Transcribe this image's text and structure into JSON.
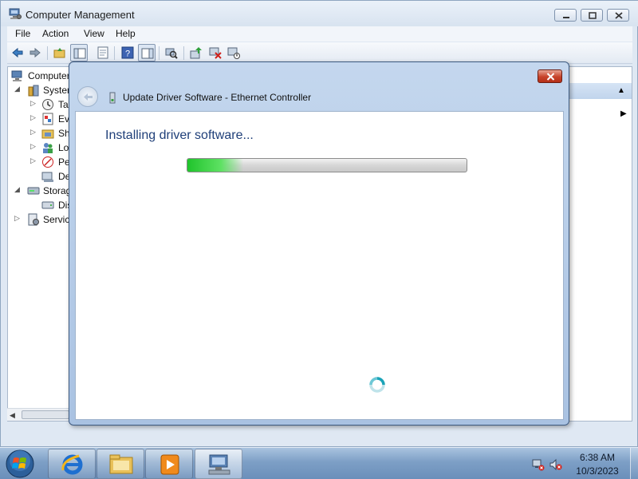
{
  "window": {
    "title": "Computer Management",
    "menu": [
      "File",
      "Action",
      "View",
      "Help"
    ]
  },
  "tree": {
    "root_label": "Computer",
    "items": [
      {
        "label": "System",
        "icon": "tools-icon",
        "expanded": true
      },
      {
        "label": "Ta",
        "icon": "clock-icon"
      },
      {
        "label": "Eve",
        "icon": "event-viewer-icon"
      },
      {
        "label": "Sh",
        "icon": "shared-folder-icon"
      },
      {
        "label": "Lo",
        "icon": "users-icon"
      },
      {
        "label": "Pe",
        "icon": "performance-icon"
      },
      {
        "label": "De",
        "icon": "device-manager-icon",
        "selected": true
      },
      {
        "label": "Storag",
        "icon": "storage-icon",
        "expanded": true
      },
      {
        "label": "Dis",
        "icon": "disk-icon"
      },
      {
        "label": "Service",
        "icon": "services-icon",
        "expanded": false
      }
    ]
  },
  "dialog": {
    "title": "Update Driver Software - Ethernet Controller",
    "heading": "Installing driver software...",
    "progress": 0.2
  },
  "taskbar": {
    "apps": [
      "internet-explorer-icon",
      "file-explorer-icon",
      "media-player-icon",
      "computer-management-icon"
    ],
    "clock_time": "6:38 AM",
    "clock_date": "10/3/2023"
  },
  "colors": {
    "dialog_heading": "#1f3f79",
    "progress_fill": "#20c42c",
    "close_button": "#c7432a"
  }
}
